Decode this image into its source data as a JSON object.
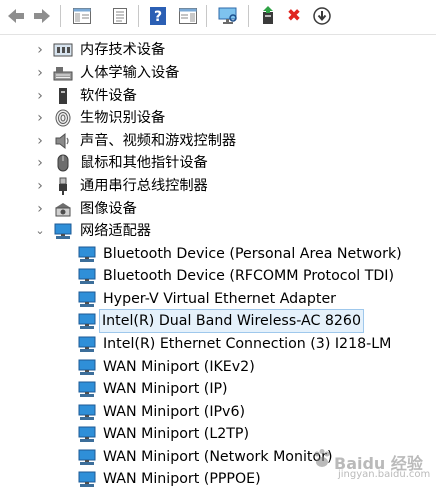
{
  "colors": {
    "selection_bg": "#e5f1fb",
    "selection_border": "#9fc8ec",
    "network_icon": "#2f8fd8",
    "delete_red": "#e0241e"
  },
  "toolbar": {
    "buttons": [
      {
        "name": "back-button",
        "icon": "arrow-left-icon"
      },
      {
        "name": "forward-button",
        "icon": "arrow-right-icon"
      },
      {
        "name": "show-hide-console-tree-button",
        "icon": "console-tree-icon"
      },
      {
        "name": "properties-button",
        "icon": "properties-icon"
      },
      {
        "name": "help-button",
        "icon": "help-icon",
        "glyph": "?"
      },
      {
        "name": "action-pane-button",
        "icon": "action-pane-icon"
      },
      {
        "name": "scan-hardware-button",
        "icon": "monitor-scan-icon"
      },
      {
        "name": "update-driver-button",
        "icon": "update-driver-icon"
      },
      {
        "name": "uninstall-device-button",
        "icon": "red-x-icon",
        "glyph": "✖"
      },
      {
        "name": "disable-device-button",
        "icon": "circle-down-arrow-icon",
        "glyph": "⬇"
      }
    ]
  },
  "tree": {
    "categories": [
      {
        "label": "内存技术设备",
        "icon": "memory-device-icon",
        "expanded": false
      },
      {
        "label": "人体学输入设备",
        "icon": "hid-keyboard-icon",
        "expanded": false
      },
      {
        "label": "软件设备",
        "icon": "software-device-icon",
        "expanded": false
      },
      {
        "label": "生物识别设备",
        "icon": "fingerprint-icon",
        "expanded": false
      },
      {
        "label": "声音、视频和游戏控制器",
        "icon": "speaker-icon",
        "expanded": false
      },
      {
        "label": "鼠标和其他指针设备",
        "icon": "mouse-icon",
        "expanded": false
      },
      {
        "label": "通用串行总线控制器",
        "icon": "usb-plug-icon",
        "expanded": false
      },
      {
        "label": "图像设备",
        "icon": "camera-icon",
        "expanded": false
      },
      {
        "label": "网络适配器",
        "icon": "network-adapter-icon",
        "expanded": true
      }
    ],
    "network_adapters": [
      {
        "label": "Bluetooth Device (Personal Area Network)",
        "selected": false
      },
      {
        "label": "Bluetooth Device (RFCOMM Protocol TDI)",
        "selected": false
      },
      {
        "label": "Hyper-V Virtual Ethernet Adapter",
        "selected": false
      },
      {
        "label": "Intel(R) Dual Band Wireless-AC 8260",
        "selected": true
      },
      {
        "label": "Intel(R) Ethernet Connection (3) I218-LM",
        "selected": false
      },
      {
        "label": "WAN Miniport (IKEv2)",
        "selected": false
      },
      {
        "label": "WAN Miniport (IP)",
        "selected": false
      },
      {
        "label": "WAN Miniport (IPv6)",
        "selected": false
      },
      {
        "label": "WAN Miniport (L2TP)",
        "selected": false
      },
      {
        "label": "WAN Miniport (Network Monitor)",
        "selected": false
      },
      {
        "label": "WAN Miniport (PPPOE)",
        "selected": false
      }
    ]
  },
  "watermark": {
    "text": "Baidu 经验",
    "url": "jingyan.baidu.com"
  }
}
